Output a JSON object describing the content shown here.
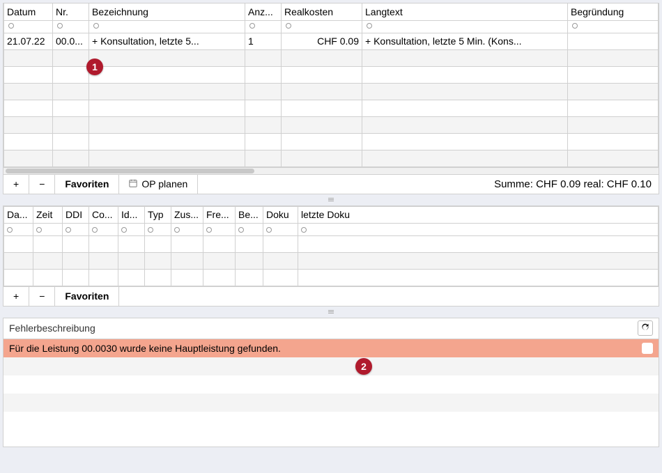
{
  "callouts": {
    "one": "1",
    "two": "2"
  },
  "top": {
    "headers": {
      "datum": "Datum",
      "nr": "Nr.",
      "bezeichnung": "Bezeichnung",
      "anz": "Anz...",
      "realkosten": "Realkosten",
      "langtext": "Langtext",
      "begruendung": "Begründung"
    },
    "row": {
      "datum": "21.07.22",
      "nr": "00.0...",
      "bezeichnung": "+ Konsultation, letzte 5...",
      "anz": "1",
      "realkosten": "CHF 0.09",
      "langtext": "+ Konsultation, letzte 5 Min. (Kons...",
      "begruendung": ""
    },
    "toolbar": {
      "plus": "+",
      "minus": "−",
      "favoriten": "Favoriten",
      "op_planen": "OP planen",
      "summe": "Summe: CHF 0.09 real: CHF 0.10"
    }
  },
  "mid": {
    "headers": {
      "da": "Da...",
      "zeit": "Zeit",
      "ddi": "DDI",
      "co": "Co...",
      "id": "Id...",
      "typ": "Typ",
      "zus": "Zus...",
      "fre": "Fre...",
      "be": "Be...",
      "doku": "Doku",
      "letzte_doku": "letzte Doku"
    },
    "toolbar": {
      "plus": "+",
      "minus": "−",
      "favoriten": "Favoriten"
    }
  },
  "err": {
    "title": "Fehlerbeschreibung",
    "message": "Für die Leistung 00.0030 wurde keine Hauptleistung gefunden."
  }
}
